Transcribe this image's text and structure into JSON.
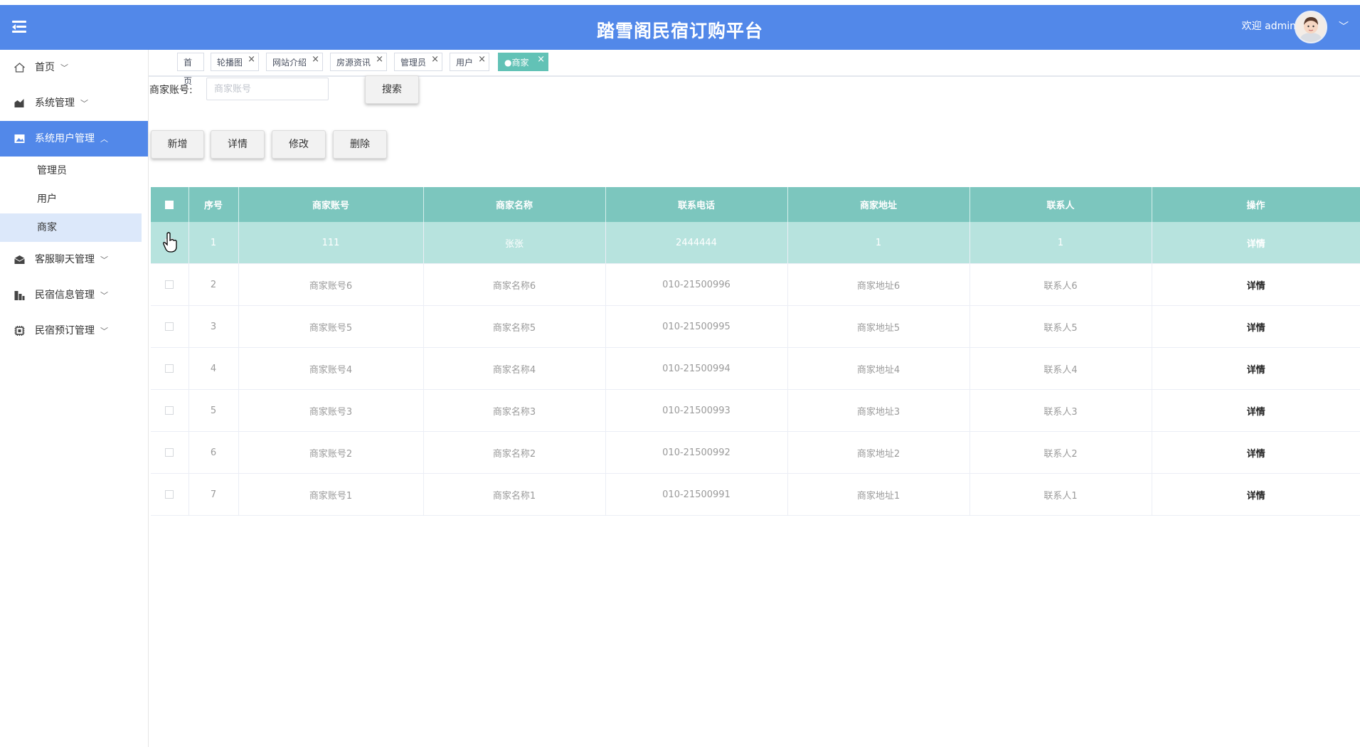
{
  "header": {
    "title": "踏雪阁民宿订购平台",
    "welcome": "欢迎 admin",
    "dropdown_glyph": "﹀"
  },
  "sidebar": {
    "items": [
      {
        "label": "首页",
        "icon": "home-icon",
        "chevron": "﹀"
      },
      {
        "label": "系统管理",
        "icon": "chart-icon",
        "chevron": "﹀"
      },
      {
        "label": "系统用户管理",
        "icon": "image-icon",
        "chevron": "︿",
        "active": true,
        "children": [
          {
            "label": "管理员"
          },
          {
            "label": "用户"
          },
          {
            "label": "商家",
            "selected": true
          }
        ]
      },
      {
        "label": "客服聊天管理",
        "icon": "mail-icon",
        "chevron": "﹀"
      },
      {
        "label": "民宿信息管理",
        "icon": "building-icon",
        "chevron": "﹀"
      },
      {
        "label": "民宿预订管理",
        "icon": "chip-icon",
        "chevron": "﹀"
      }
    ]
  },
  "tabs": [
    {
      "label": "首页"
    },
    {
      "label": "轮播图",
      "close": "×"
    },
    {
      "label": "网站介绍",
      "close": "×"
    },
    {
      "label": "房源资讯",
      "close": "×"
    },
    {
      "label": "管理员",
      "close": "×"
    },
    {
      "label": "用户",
      "close": "×"
    },
    {
      "label": "●商家",
      "close": "×",
      "active": true
    }
  ],
  "search": {
    "label": "商家账号:",
    "placeholder": "商家账号",
    "value": "",
    "button": "搜索"
  },
  "toolbar": {
    "add": "新增",
    "detail": "详情",
    "edit": "修改",
    "delete": "删除"
  },
  "table": {
    "columns": [
      "序号",
      "商家账号",
      "商家名称",
      "联系电话",
      "商家地址",
      "联系人",
      "操作"
    ],
    "rows": [
      {
        "no": "1",
        "account": "111",
        "name": "张张",
        "phone": "2444444",
        "address": "1",
        "contact": "1",
        "op": "详情",
        "highlighted": true
      },
      {
        "no": "2",
        "account": "商家账号6",
        "name": "商家名称6",
        "phone": "010-21500996",
        "address": "商家地址6",
        "contact": "联系人6",
        "op": "详情"
      },
      {
        "no": "3",
        "account": "商家账号5",
        "name": "商家名称5",
        "phone": "010-21500995",
        "address": "商家地址5",
        "contact": "联系人5",
        "op": "详情"
      },
      {
        "no": "4",
        "account": "商家账号4",
        "name": "商家名称4",
        "phone": "010-21500994",
        "address": "商家地址4",
        "contact": "联系人4",
        "op": "详情"
      },
      {
        "no": "5",
        "account": "商家账号3",
        "name": "商家名称3",
        "phone": "010-21500993",
        "address": "商家地址3",
        "contact": "联系人3",
        "op": "详情"
      },
      {
        "no": "6",
        "account": "商家账号2",
        "name": "商家名称2",
        "phone": "010-21500992",
        "address": "商家地址2",
        "contact": "联系人2",
        "op": "详情"
      },
      {
        "no": "7",
        "account": "商家账号1",
        "name": "商家名称1",
        "phone": "010-21500991",
        "address": "商家地址1",
        "contact": "联系人1",
        "op": "详情"
      }
    ]
  },
  "colors": {
    "header_bg": "#5288e9",
    "active_menu_bg": "#5288e9",
    "table_header_bg": "#7cc6be",
    "highlight_row_bg": "#b7e3de",
    "active_tab_bg": "#62c2b6"
  }
}
